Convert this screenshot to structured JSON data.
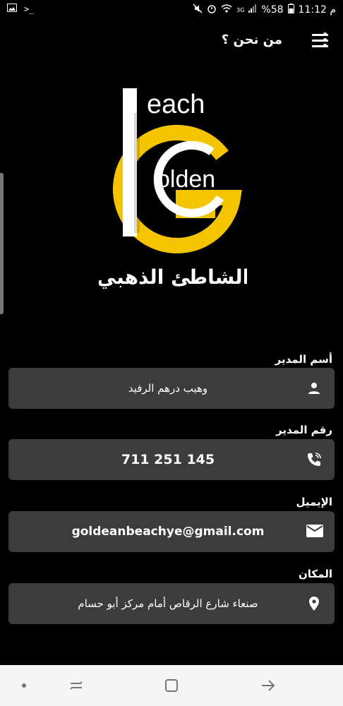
{
  "status_bar": {
    "time": "11:12 م",
    "battery": "%58",
    "network": "3G"
  },
  "app_bar": {
    "title": "من نحن ؟"
  },
  "logo": {
    "word_top": "each",
    "word_middle": "olden",
    "arabic_name": "الشاطئ الذهبي",
    "accent_color": "#f5c400"
  },
  "fields": [
    {
      "label": "أسم المدير",
      "value": "وهيب درهم الرفيد",
      "icon": "person-icon"
    },
    {
      "label": "رقم المدير",
      "value": "711 251 145",
      "icon": "phone-icon"
    },
    {
      "label": "الإيميل",
      "value": "goldeanbeachye@gmail.com",
      "icon": "mail-icon"
    },
    {
      "label": "المكان",
      "value": "صنعاء شارع الرقاص أمام مركز أبو حسام",
      "icon": "location-pin-icon"
    }
  ],
  "colors": {
    "background": "#000000",
    "field_background": "#3c3c3c",
    "nav_bar": "#f5f5f5"
  }
}
